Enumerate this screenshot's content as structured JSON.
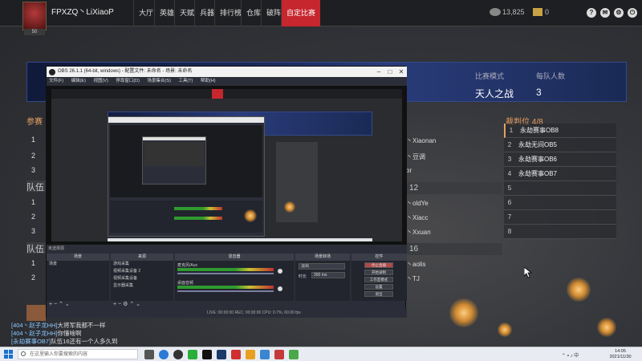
{
  "header": {
    "player_name": "FPXZQ丶LiXiaoP",
    "avatar_level": "50",
    "nav": [
      "大厅",
      "英雄",
      "天赋",
      "兵器",
      "排行榜",
      "仓库",
      "破阵",
      "自定比赛"
    ],
    "active_nav": "自定比赛",
    "currency1": "13,825",
    "currency2": "0"
  },
  "banner": {
    "match_mode_label": "比赛模式",
    "match_mode_value": "天人之战",
    "per_team_label": "每队人数",
    "per_team_value": "3"
  },
  "teams_panel": {
    "label": "参赛",
    "team_heads": [
      "队伍",
      "队伍"
    ],
    "rows": [
      "1",
      "2",
      "3",
      "1",
      "2",
      "3",
      "1",
      "2"
    ]
  },
  "right_column": {
    "entries": [
      "丶Xiaonan",
      "丶豆调",
      "or",
      "丶oldYe",
      "丶Xiacc",
      "丶Xxuan",
      "丶aolis",
      "丶TJ"
    ],
    "heads": [
      "12",
      "16"
    ]
  },
  "referee": {
    "title": "裁判位 4/8",
    "rows": [
      {
        "num": "1",
        "name": "永劫赛事OB8"
      },
      {
        "num": "2",
        "name": "永劫无间OB5"
      },
      {
        "num": "3",
        "name": "永劫赛事OB6"
      },
      {
        "num": "4",
        "name": "永劫赛事OB7"
      },
      {
        "num": "5",
        "name": ""
      },
      {
        "num": "6",
        "name": ""
      },
      {
        "num": "7",
        "name": ""
      },
      {
        "num": "8",
        "name": ""
      }
    ]
  },
  "obs": {
    "title": "OBS 26.1.1 (64-bit, windows) - 配置文件: 未命名 - 场景: 未命名",
    "menu": [
      "文件(F)",
      "编辑(E)",
      "视图(V)",
      "停靠窗口(D)",
      "场景集合(S)",
      "工具(T)",
      "帮助(H)"
    ],
    "scene_name": "未选择源",
    "docks": [
      "场景",
      "来源",
      "混音器",
      "场景转场",
      "控件"
    ],
    "scenes": [
      "场景"
    ],
    "sources": [
      "游戏采集",
      "视频采集设备 2",
      "视频采集设备",
      "显示器采集"
    ],
    "mixer": [
      "麦克风/Aux",
      "桌面音频"
    ],
    "transition_type": "淡出",
    "transition_duration_label": "时长",
    "transition_duration": "300 ms",
    "controls": [
      "停止直播",
      "开始录制",
      "工作室模式",
      "设置",
      "退出"
    ],
    "status": "LIVE: 00:00:00  REC: 00:00:00  CPU: 0.7%, 60.00 fps"
  },
  "chat": [
    {
      "tag": "[404丶赵子龙HH]",
      "text": "大将军我都不一样"
    },
    {
      "tag": "[404丶赵子龙HH]",
      "text": "你懂啥啊"
    },
    {
      "tag": "[永劫赛事OB7]",
      "text": "队伍16还有一个人多久到"
    }
  ],
  "taskbar": {
    "search_placeholder": "在这里输入你要搜索的内容",
    "time": "14:05",
    "date": "2021/11/30"
  }
}
